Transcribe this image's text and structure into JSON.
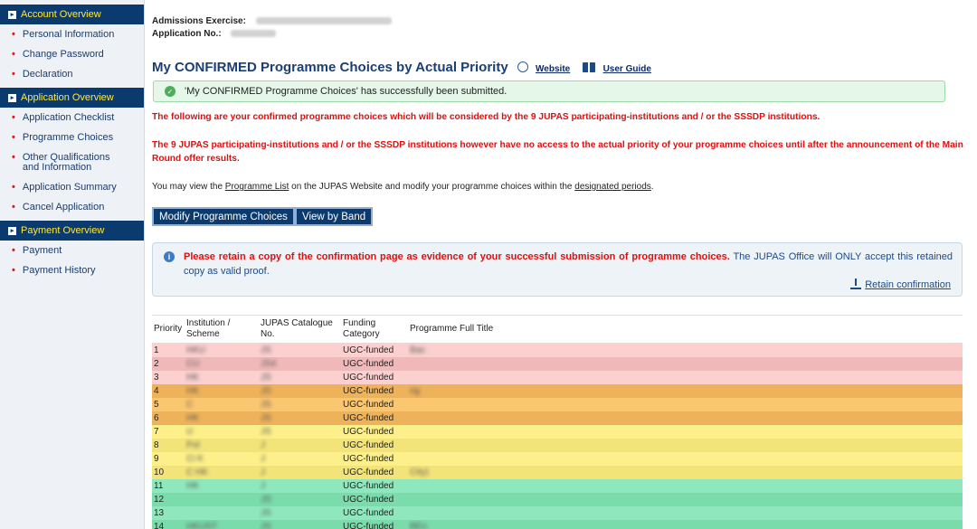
{
  "sidebar": {
    "sections": [
      {
        "label": "Account Overview",
        "items": [
          "Personal Information",
          "Change Password",
          "Declaration"
        ]
      },
      {
        "label": "Application Overview",
        "items": [
          "Application Checklist",
          "Programme Choices",
          "Other Qualifications and Information",
          "Application Summary",
          "Cancel Application"
        ]
      },
      {
        "label": "Payment Overview",
        "items": [
          "Payment",
          "Payment History"
        ]
      }
    ]
  },
  "header": {
    "exercise_label": "Admissions Exercise:",
    "appno_label": "Application No.:"
  },
  "title": {
    "text": "My CONFIRMED Programme Choices by Actual Priority",
    "website_label": "Website",
    "guide_label": "User Guide"
  },
  "success_message": "'My CONFIRMED Programme Choices' has successfully been submitted.",
  "red_text_1": "The following are your confirmed programme choices which will be considered by the 9 JUPAS participating-institutions and / or the SSSDP institutions.",
  "red_text_2": "The 9 JUPAS participating-institutions and / or the SSSDP institutions however have no access to the actual priority of your programme choices until after the announcement of the Main Round offer results.",
  "info": {
    "prefix": "You may view the ",
    "programme_list_link": "Programme List",
    "middle": " on the JUPAS Website and modify your programme choices within the ",
    "periods_link": "designated periods",
    "suffix": "."
  },
  "buttons": {
    "modify": "Modify Programme Choices",
    "view_band": "View by Band"
  },
  "notice": {
    "bold": "Please retain a copy of the confirmation page as evidence of your successful submission of programme choices.",
    "rest": " The JUPAS Office will ONLY accept this retained copy as valid proof.",
    "retain_link": "Retain confirmation"
  },
  "table": {
    "headers": [
      "Priority",
      "Institution / Scheme",
      "JUPAS Catalogue No.",
      "Funding Category",
      "Programme Full Title"
    ],
    "rows": [
      {
        "priority": "1",
        "inst": "HKU",
        "cat": "JS",
        "fund": "UGC-funded",
        "title": "Bac",
        "band": "c-pink"
      },
      {
        "priority": "2",
        "inst": "CU",
        "cat": "JS4",
        "fund": "UGC-funded",
        "title": "",
        "band": "c-pink2"
      },
      {
        "priority": "3",
        "inst": "HK",
        "cat": "JS",
        "fund": "UGC-funded",
        "title": "",
        "band": "c-pink"
      },
      {
        "priority": "4",
        "inst": "HK",
        "cat": "JS",
        "fund": "UGC-funded",
        "title": "ng",
        "band": "c-orange2"
      },
      {
        "priority": "5",
        "inst": "C",
        "cat": "JS",
        "fund": "UGC-funded",
        "title": "",
        "band": "c-orange"
      },
      {
        "priority": "6",
        "inst": "HK",
        "cat": "JS",
        "fund": "UGC-funded",
        "title": "",
        "band": "c-orange2"
      },
      {
        "priority": "7",
        "inst": "U",
        "cat": "JS",
        "fund": "UGC-funded",
        "title": "",
        "band": "c-yellow"
      },
      {
        "priority": "8",
        "inst": "Pol",
        "cat": "J",
        "fund": "UGC-funded",
        "title": "",
        "band": "c-yellow2"
      },
      {
        "priority": "9",
        "inst": "Ci  K",
        "cat": "J",
        "fund": "UGC-funded",
        "title": "",
        "band": "c-yellow"
      },
      {
        "priority": "10",
        "inst": "C  HK",
        "cat": "J",
        "fund": "UGC-funded",
        "title": "City)",
        "band": "c-yellow2"
      },
      {
        "priority": "11",
        "inst": "HK",
        "cat": "J",
        "fund": "UGC-funded",
        "title": "",
        "band": "c-green"
      },
      {
        "priority": "12",
        "inst": "",
        "cat": "JS",
        "fund": "UGC-funded",
        "title": "",
        "band": "c-green2"
      },
      {
        "priority": "13",
        "inst": "",
        "cat": "JS",
        "fund": "UGC-funded",
        "title": "",
        "band": "c-green"
      },
      {
        "priority": "14",
        "inst": "HKUST",
        "cat": "JS",
        "fund": "UGC-funded",
        "title": "BEn",
        "band": "c-green2"
      }
    ]
  }
}
